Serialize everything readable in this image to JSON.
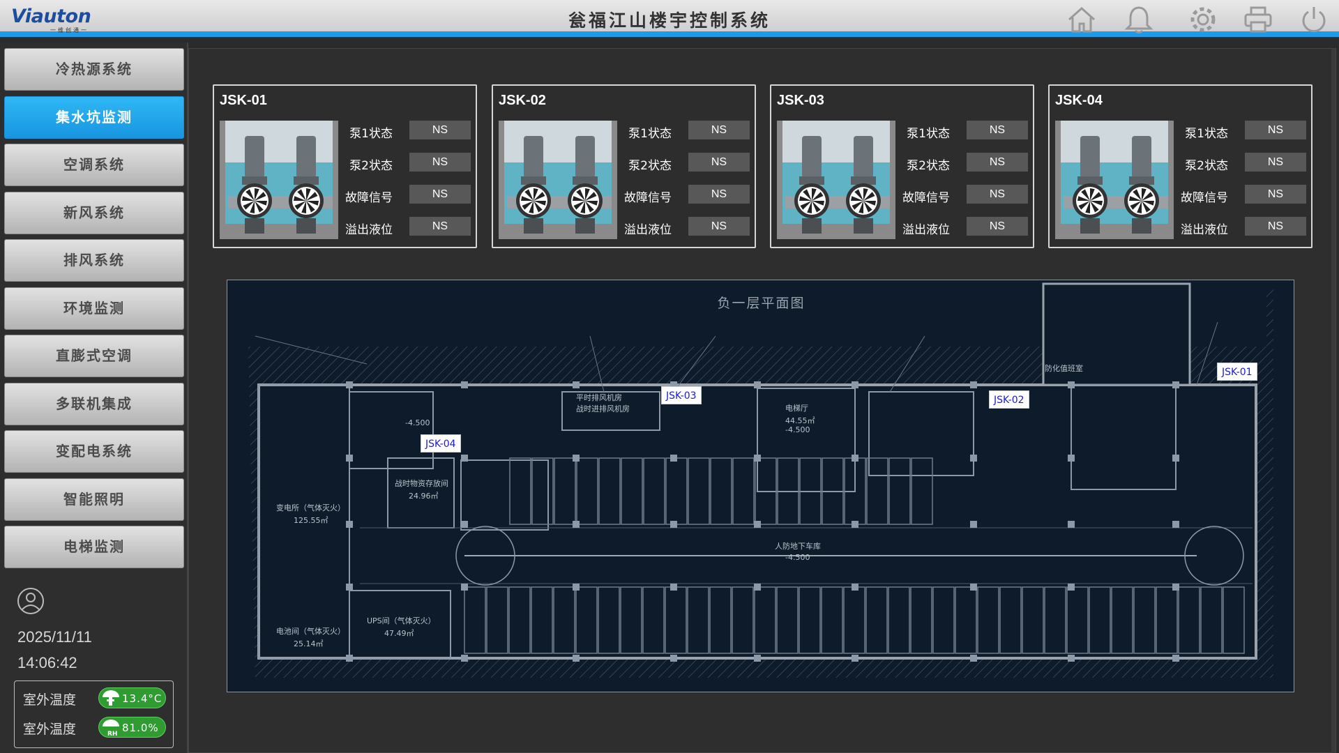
{
  "header": {
    "logo_text": "Viauton",
    "logo_sub": "一维创通一",
    "title": "瓮福江山楼宇控制系统",
    "icons": [
      "home-icon",
      "bell-icon",
      "gear-icon",
      "printer-icon",
      "power-icon"
    ]
  },
  "sidebar": {
    "items": [
      {
        "label": "冷热源系统",
        "active": false
      },
      {
        "label": "集水坑监测",
        "active": true
      },
      {
        "label": "空调系统",
        "active": false
      },
      {
        "label": "新风系统",
        "active": false
      },
      {
        "label": "排风系统",
        "active": false
      },
      {
        "label": "环境监测",
        "active": false
      },
      {
        "label": "直膨式空调",
        "active": false
      },
      {
        "label": "多联机集成",
        "active": false
      },
      {
        "label": "变配电系统",
        "active": false
      },
      {
        "label": "智能照明",
        "active": false
      },
      {
        "label": "电梯监测",
        "active": false
      }
    ],
    "date": "2025/11/11",
    "time": "14:06:42",
    "weather": [
      {
        "label": "室外温度",
        "value": "13.4°C",
        "icon": "thermometer-icon"
      },
      {
        "label": "室外温度",
        "value": "81.0%",
        "icon": "humidity-icon"
      }
    ]
  },
  "cards": [
    {
      "title": "JSK-01",
      "rows": [
        {
          "label": "泵1状态",
          "value": "NS"
        },
        {
          "label": "泵2状态",
          "value": "NS"
        },
        {
          "label": "故障信号",
          "value": "NS"
        },
        {
          "label": "溢出液位",
          "value": "NS"
        }
      ]
    },
    {
      "title": "JSK-02",
      "rows": [
        {
          "label": "泵1状态",
          "value": "NS"
        },
        {
          "label": "泵2状态",
          "value": "NS"
        },
        {
          "label": "故障信号",
          "value": "NS"
        },
        {
          "label": "溢出液位",
          "value": "NS"
        }
      ]
    },
    {
      "title": "JSK-03",
      "rows": [
        {
          "label": "泵1状态",
          "value": "NS"
        },
        {
          "label": "泵2状态",
          "value": "NS"
        },
        {
          "label": "故障信号",
          "value": "NS"
        },
        {
          "label": "溢出液位",
          "value": "NS"
        }
      ]
    },
    {
      "title": "JSK-04",
      "rows": [
        {
          "label": "泵1状态",
          "value": "NS"
        },
        {
          "label": "泵2状态",
          "value": "NS"
        },
        {
          "label": "故障信号",
          "value": "NS"
        },
        {
          "label": "溢出液位",
          "value": "NS"
        }
      ]
    }
  ],
  "floor_plan": {
    "title": "负一层平面图",
    "pins": [
      "JSK-01",
      "JSK-02",
      "JSK-03",
      "JSK-04"
    ],
    "labels": [
      "变电所（气体灭火）",
      "125.55㎡",
      "电池间（气体灭火）",
      "25.14㎡",
      "UPS间（气体灭火）",
      "47.49㎡",
      "战时物资存放间",
      "24.96㎡",
      "电梯厅",
      "44.55㎡",
      "-4.500",
      "人防地下车库",
      "-4.500",
      "平时排风机房",
      "战时进排风机房",
      "防化值班室",
      "-4.500"
    ]
  },
  "colors": {
    "accent": "#1d9be8",
    "active_menu": "#2fb8f5",
    "pill_green": "#2e9c30",
    "plan_bg": "#0d1b2a"
  }
}
